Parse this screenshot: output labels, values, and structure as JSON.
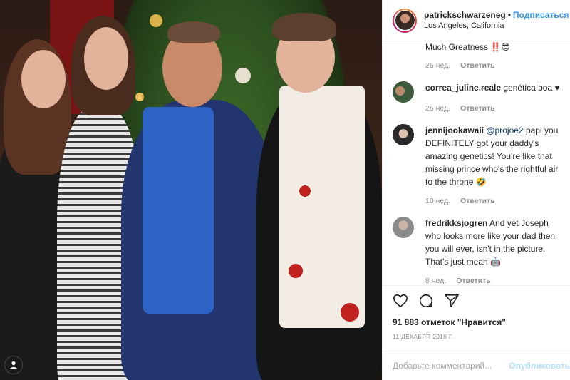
{
  "post": {
    "username": "patrickschwarzeneg",
    "dot": "•",
    "follow_label": "Подписаться",
    "location": "Los Angeles, California"
  },
  "comments": {
    "partial_text": "Much Greatness ‼️😎",
    "partial_time": "26 нед.",
    "reply_label": "Ответить",
    "items": [
      {
        "user": "correa_juline.reale",
        "mention": "",
        "text": "genética boa ♥",
        "time": "26 нед."
      },
      {
        "user": "jennijookawaii",
        "mention": "@projoe2",
        "text": "papi you DEFINITELY got your daddy's amazing genetics! You're like that missing prince who's the rightful air to the throne 🤣",
        "time": "10 нед."
      },
      {
        "user": "fredrikksjogren",
        "mention": "",
        "text": "And yet Joseph who looks more like your dad then you will ever, isn't in the picture. That's just mean 🤖",
        "time": "8 нед."
      }
    ]
  },
  "actions": {
    "like_icon": "heart-icon",
    "comment_icon": "comment-icon",
    "share_icon": "share-icon",
    "likes_text": "91 883 отметок \"Нравится\"",
    "date": "11 ДЕКАБРЯ 2018 Г."
  },
  "add_comment": {
    "placeholder": "Добавьте комментарий...",
    "publish_label": "Опубликовать"
  },
  "colors": {
    "accent": "#3897f0",
    "publish_disabled": "#b2dffc",
    "muted": "#8e8e8e"
  }
}
